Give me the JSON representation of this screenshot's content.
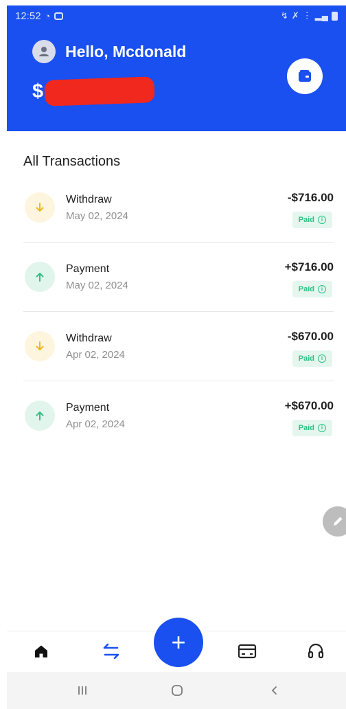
{
  "status_bar": {
    "time": "12:52"
  },
  "header": {
    "greeting": "Hello, Mcdonald",
    "currency_symbol": "$"
  },
  "transactions": {
    "title": "All Transactions",
    "items": [
      {
        "type": "Withdraw",
        "date": "May 02, 2024",
        "amount": "-$716.00",
        "status": "Paid",
        "direction": "down"
      },
      {
        "type": "Payment",
        "date": "May 02, 2024",
        "amount": "+$716.00",
        "status": "Paid",
        "direction": "up"
      },
      {
        "type": "Withdraw",
        "date": "Apr 02, 2024",
        "amount": "-$670.00",
        "status": "Paid",
        "direction": "down"
      },
      {
        "type": "Payment",
        "date": "Apr 02, 2024",
        "amount": "+$670.00",
        "status": "Paid",
        "direction": "up"
      }
    ]
  },
  "bottom_nav": {
    "items": [
      "home-icon",
      "transfer-icon",
      "add-icon",
      "card-icon",
      "support-icon"
    ],
    "add_label": "+"
  },
  "colors": {
    "primary": "#1a4ff0",
    "withdraw_accent": "#f2b622",
    "payment_accent": "#2fbf84",
    "paid_badge_bg": "#e4f6ee"
  }
}
